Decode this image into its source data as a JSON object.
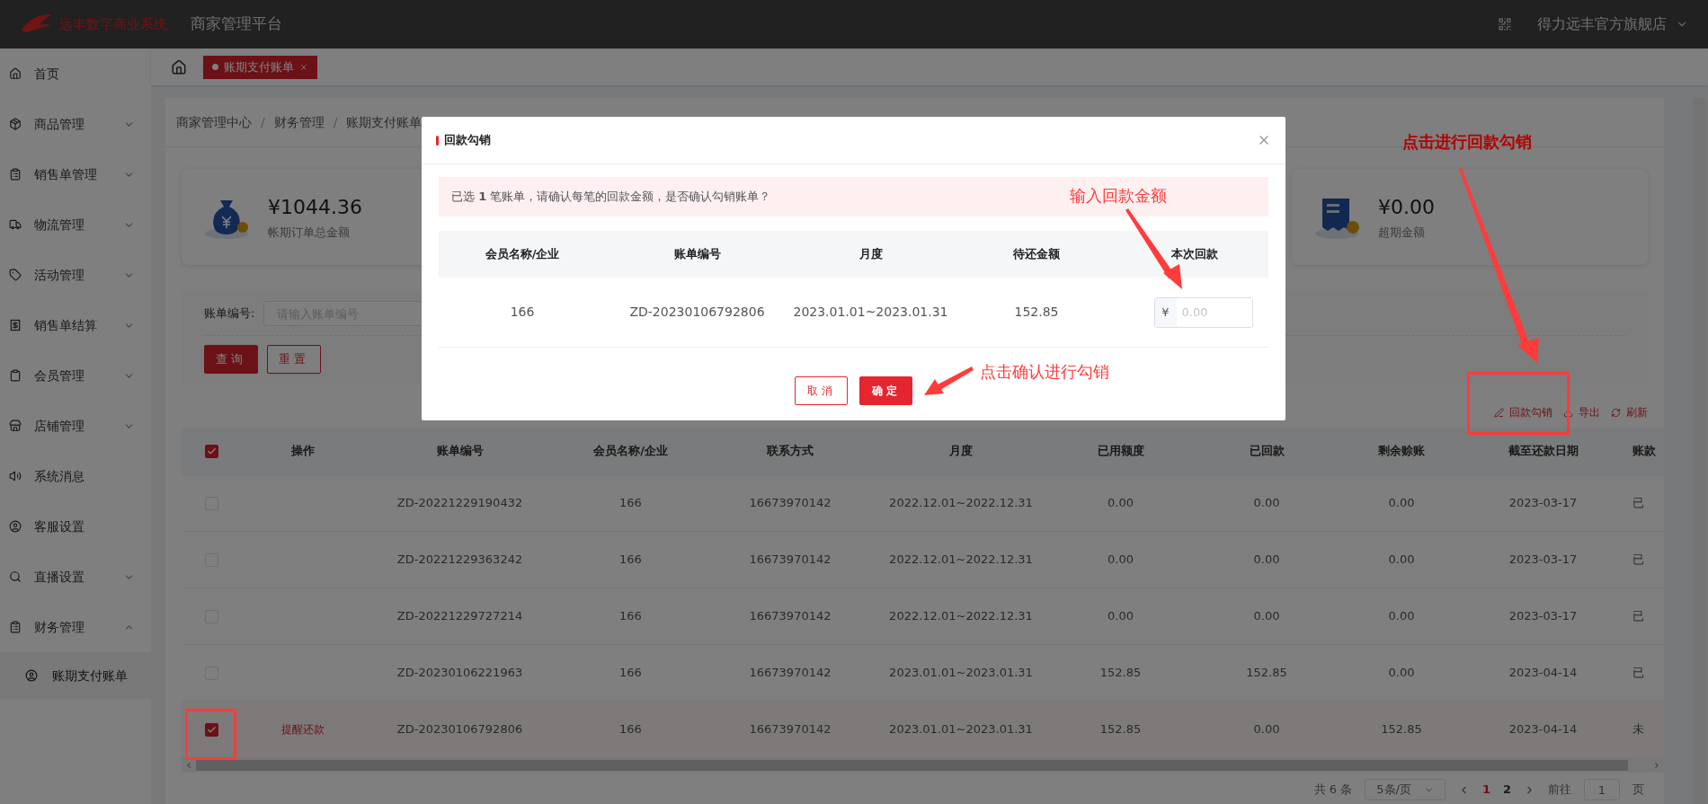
{
  "header": {
    "logo_text": "远丰数字商业系统",
    "title": "商家管理平台",
    "store": "得力远丰官方旗舰店"
  },
  "sidebar": {
    "items": [
      {
        "label": "首页",
        "kind": "link"
      },
      {
        "label": "商品管理",
        "kind": "group",
        "expanded": false
      },
      {
        "label": "销售单管理",
        "kind": "group",
        "expanded": false
      },
      {
        "label": "物流管理",
        "kind": "group",
        "expanded": false
      },
      {
        "label": "活动管理",
        "kind": "group",
        "expanded": false
      },
      {
        "label": "销售单结算",
        "kind": "group",
        "expanded": false
      },
      {
        "label": "会员管理",
        "kind": "group",
        "expanded": false
      },
      {
        "label": "店铺管理",
        "kind": "group",
        "expanded": false
      },
      {
        "label": "系统消息",
        "kind": "link"
      },
      {
        "label": "客服设置",
        "kind": "link"
      },
      {
        "label": "直播设置",
        "kind": "group",
        "expanded": false
      },
      {
        "label": "财务管理",
        "kind": "group",
        "expanded": true,
        "children": [
          {
            "label": "账期支付账单",
            "selected": true
          }
        ]
      }
    ]
  },
  "tabs": [
    {
      "label": "账期支付账单",
      "selected": true
    }
  ],
  "breadcrumb": {
    "separator": "/",
    "items": [
      "商家管理中心",
      "财务管理",
      "账期支付账单"
    ]
  },
  "stats": [
    {
      "amount": "¥1044.36",
      "label": "帐期订单总金额"
    },
    {
      "amount": "¥0.00",
      "label": "超期金额"
    }
  ],
  "search": {
    "label": "账单编号:",
    "placeholder": "请输入账单编号",
    "buttons": [
      "查询",
      "重置"
    ]
  },
  "toolbar": [
    "回款勾销",
    "导出",
    "刷新"
  ],
  "table": {
    "header_checked": true,
    "columns": [
      "操作",
      "账单编号",
      "会员名称/企业",
      "联系方式",
      "月度",
      "已用额度",
      "已回款",
      "剩余赊账",
      "截至还款日期",
      "账款"
    ],
    "rows": [
      {
        "selected": false,
        "cells": [
          "",
          "ZD-20221229190432",
          "166",
          "16673970142",
          "2022.12.01~2022.12.31",
          "0.00",
          "0.00",
          "0.00",
          "2023-03-17",
          "已"
        ]
      },
      {
        "selected": false,
        "cells": [
          "",
          "ZD-20221229363242",
          "166",
          "16673970142",
          "2022.12.01~2022.12.31",
          "0.00",
          "0.00",
          "0.00",
          "2023-03-17",
          "已"
        ]
      },
      {
        "selected": false,
        "cells": [
          "",
          "ZD-20221229727214",
          "166",
          "16673970142",
          "2022.12.01~2022.12.31",
          "0.00",
          "0.00",
          "0.00",
          "2023-03-17",
          "已"
        ]
      },
      {
        "selected": false,
        "cells": [
          "",
          "ZD-20230106221963",
          "166",
          "16673970142",
          "2023.01.01~2023.01.31",
          "152.85",
          "152.85",
          "0.00",
          "2023-04-14",
          "已"
        ]
      },
      {
        "selected": true,
        "cells": [
          "提醒还款",
          "ZD-20230106792806",
          "166",
          "16673970142",
          "2023.01.01~2023.01.31",
          "152.85",
          "0.00",
          "152.85",
          "2023-04-14",
          "未"
        ]
      }
    ]
  },
  "pagination": {
    "total": "共 6 条",
    "page_size": "5条/页",
    "pages": [
      {
        "label": "1",
        "selected": true
      },
      {
        "label": "2",
        "selected": false
      }
    ],
    "jump_label": "前往",
    "jump_value": "1",
    "unit": "页"
  },
  "modal": {
    "title": "回款勾销",
    "notice": "已选 **1** 笔账单，请确认每笔的回款金额，是否确认勾销账单？",
    "columns": [
      "会员名称/企业",
      "账单编号",
      "月度",
      "待还金额",
      "本次回款"
    ],
    "row": {
      "cells": [
        "166",
        "ZD-20230106792806",
        "2023.01.01~2023.01.31",
        "152.85"
      ],
      "currency": "¥",
      "placeholder": "0.00"
    },
    "buttons": [
      "取消",
      "确定"
    ]
  },
  "annotations": [
    "点击进行回款勾销",
    "输入回款金额",
    "点击确认进行勾销"
  ]
}
